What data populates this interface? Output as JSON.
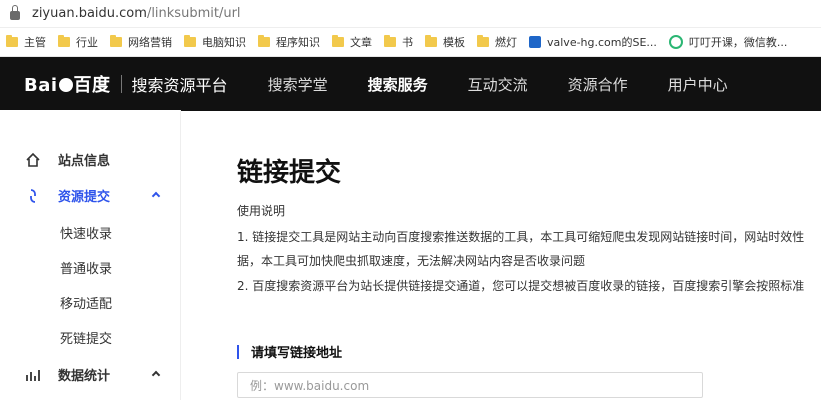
{
  "browser": {
    "url_main": "ziyuan.baidu.com",
    "url_path": "/linksubmit/url",
    "bookmarks": [
      "主管",
      "行业",
      "网络营销",
      "电脑知识",
      "程序知识",
      "文章",
      "书",
      "模板",
      "燃灯",
      "valve-hg.com的SE...",
      "叮叮开课，微信教..."
    ]
  },
  "topnav": {
    "brand_left": "Bai",
    "brand_right": "百度",
    "title": "搜索资源平台",
    "items": [
      "搜索学堂",
      "搜索服务",
      "互动交流",
      "资源合作",
      "用户中心"
    ],
    "active_index": 1
  },
  "sidebar": {
    "items": [
      {
        "label": "站点信息",
        "icon": "home-icon"
      },
      {
        "label": "资源提交",
        "icon": "link-icon",
        "active": true
      },
      {
        "label": "快速收录"
      },
      {
        "label": "普通收录"
      },
      {
        "label": "移动适配"
      },
      {
        "label": "死链提交"
      },
      {
        "label": "数据统计",
        "icon": "chart-icon"
      }
    ]
  },
  "main": {
    "title": "链接提交",
    "usage_label": "使用说明",
    "lines": [
      "1. 链接提交工具是网站主动向百度搜索推送数据的工具，本工具可缩短爬虫发现网站链接时间，网站时效性",
      "据，本工具可加快爬虫抓取速度，无法解决网站内容是否收录问题",
      "2. 百度搜索资源平台为站长提供链接提交通道，您可以提交想被百度收录的链接，百度搜索引擎会按照标准"
    ],
    "section_title": "请填写链接地址",
    "input_placeholder": "例：www.baidu.com"
  },
  "colors": {
    "accent": "#2f54eb",
    "nav_bg": "#111111"
  }
}
